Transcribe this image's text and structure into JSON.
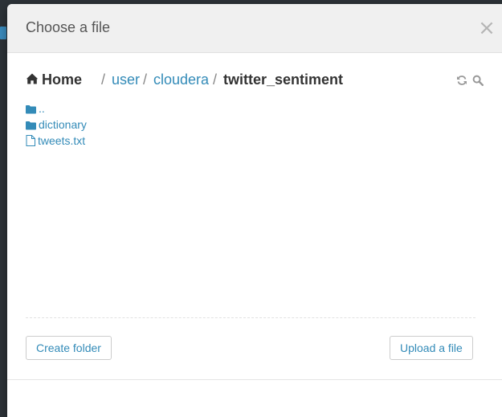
{
  "dialog": {
    "title": "Choose a file",
    "close_label": "×"
  },
  "breadcrumb": {
    "home": "Home",
    "separator": "/",
    "parts": [
      "user",
      "cloudera"
    ],
    "current": "twitter_sentiment"
  },
  "toolbar": {
    "icons": [
      "refresh-icon",
      "search-icon"
    ]
  },
  "files": [
    {
      "name": "..",
      "type": "folder"
    },
    {
      "name": "dictionary",
      "type": "folder"
    },
    {
      "name": "tweets.txt",
      "type": "file"
    }
  ],
  "actions": {
    "create_folder": "Create folder",
    "upload_file": "Upload a file"
  },
  "colors": {
    "link": "#338bb8",
    "text": "#333333",
    "header_bg": "#f0f0f0"
  }
}
